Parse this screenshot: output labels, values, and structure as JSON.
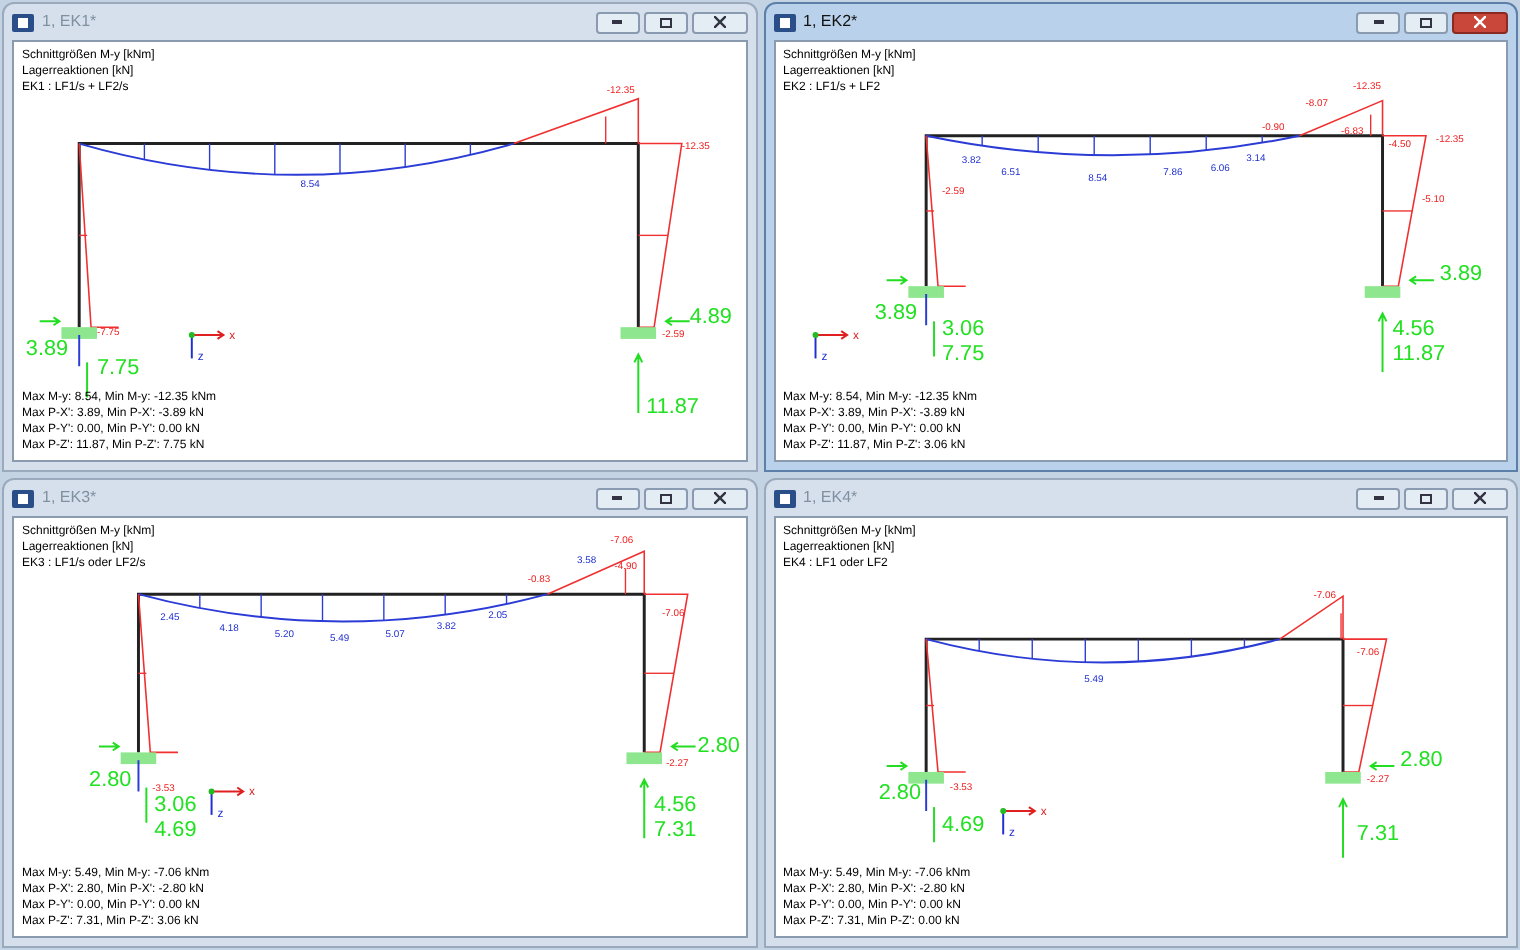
{
  "windows": [
    {
      "title": "1, EK1*",
      "active": false,
      "header": [
        "Schnittgrößen M-y [kNm]",
        "Lagerreaktionen [kN]",
        "EK1 : LF1/s + LF2/s"
      ],
      "moments": [
        "-12.35",
        "-12.35",
        "8.54",
        "-7.75",
        "-2.59"
      ],
      "reactions": [
        "3.89",
        "7.75",
        "4.89",
        "11.87"
      ],
      "axis": [
        "x",
        "z"
      ],
      "summary": [
        "Max M-y: 8.54, Min M-y: -12.35 kNm",
        "Max P-X': 3.89, Min P-X': -3.89 kN",
        "Max P-Y': 0.00, Min P-Y': 0.00 kN",
        "Max P-Z': 11.87, Min P-Z': 7.75 kN"
      ]
    },
    {
      "title": "1, EK2*",
      "active": true,
      "header": [
        "Schnittgrößen M-y [kNm]",
        "Lagerreaktionen [kN]",
        "EK2 : LF1/s + LF2"
      ],
      "moments": [
        "-12.35",
        "-8.07",
        "-6.83",
        "-0.90",
        "3.82",
        "6.51",
        "8.54",
        "7.86",
        "6.06",
        "3.14",
        "-4.50",
        "-12.35",
        "-2.59",
        "-5.10"
      ],
      "reactions": [
        "3.89",
        "3.06",
        "7.75",
        "4.56",
        "11.87",
        "3.89"
      ],
      "axis": [
        "x",
        "z"
      ],
      "summary": [
        "Max M-y: 8.54, Min M-y: -12.35 kNm",
        "Max P-X': 3.89, Min P-X': -3.89 kN",
        "Max P-Y': 0.00, Min P-Y': 0.00 kN",
        "Max P-Z': 11.87, Min P-Z': 3.06 kN"
      ]
    },
    {
      "title": "1, EK3*",
      "active": false,
      "header": [
        "Schnittgrößen M-y [kNm]",
        "Lagerreaktionen [kN]",
        "EK3 : LF1/s oder LF2/s"
      ],
      "moments": [
        "-7.06",
        "3.58",
        "-4.90",
        "-0.83",
        "2.45",
        "4.18",
        "5.20",
        "5.49",
        "5.07",
        "3.82",
        "2.05",
        "-7.06",
        "-3.53",
        "-2.27"
      ],
      "reactions": [
        "2.80",
        "3.06",
        "4.69",
        "2.80",
        "4.56",
        "7.31"
      ],
      "axis": [
        "x",
        "z"
      ],
      "summary": [
        "Max M-y: 5.49, Min M-y: -7.06 kNm",
        "Max P-X': 2.80, Min P-X': -2.80 kN",
        "Max P-Y': 0.00, Min P-Y': 0.00 kN",
        "Max P-Z': 7.31, Min P-Z': 3.06 kN"
      ]
    },
    {
      "title": "1, EK4*",
      "active": false,
      "header": [
        "Schnittgrößen M-y [kNm]",
        "Lagerreaktionen [kN]",
        "EK4 : LF1 oder LF2"
      ],
      "moments": [
        "-7.06",
        "-7.06",
        "5.49",
        "-3.53",
        "-2.27"
      ],
      "reactions": [
        "2.80",
        "4.69",
        "2.80",
        "7.31"
      ],
      "axis": [
        "x",
        "z"
      ],
      "summary": [
        "Max M-y: 5.49, Min M-y: -7.06 kNm",
        "Max P-X': 2.80, Min P-X': -2.80 kN",
        "Max P-Y': 0.00, Min P-Y': 0.00 kN",
        "Max P-Z': 7.31, Min P-Z': 0.00 kN"
      ]
    }
  ]
}
